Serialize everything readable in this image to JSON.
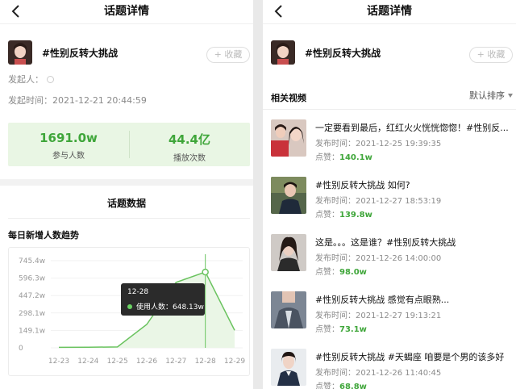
{
  "header": {
    "title": "话题详情"
  },
  "topic": {
    "name": "#性别反转大挑战",
    "fav_label": "+ 收藏"
  },
  "left": {
    "initiator_label": "发起人：",
    "start_time": "发起时间：2021-12-21 20:44:59",
    "stats": [
      {
        "value": "1691.0w",
        "label": "参与人数"
      },
      {
        "value": "44.4亿",
        "label": "播放次数"
      }
    ],
    "section_title": "话题数据",
    "trend_title": "每日新增人数趋势"
  },
  "chart_data": {
    "type": "area",
    "x": [
      "12-23",
      "12-24",
      "12-25",
      "12-26",
      "12-27",
      "12-28",
      "12-29"
    ],
    "y_ticks": [
      "745.4w",
      "596.3w",
      "447.2w",
      "298.1w",
      "149.1w",
      "0"
    ],
    "ylim": [
      0,
      745.4
    ],
    "series": [
      {
        "values": [
          4,
          5,
          8,
          200,
          560,
          648.13,
          150
        ]
      }
    ],
    "tooltip": {
      "date": "12-28",
      "label": "使用人数：",
      "value": "648.13w"
    },
    "color": "#6ac35f"
  },
  "right": {
    "related_title": "相关视频",
    "sort_label": "默认排序",
    "videos": [
      {
        "title": "一定要看到最后，红红火火恍恍惚惚！#性别反...",
        "time": "发布时间：2021-12-25 19:39:35",
        "likes_label": "点赞：",
        "likes": "140.1w"
      },
      {
        "title": "#性别反转大挑战 如何?",
        "time": "发布时间：2021-12-27 18:53:19",
        "likes_label": "点赞：",
        "likes": "139.8w"
      },
      {
        "title": "这是。。。这是谁？#性别反转大挑战",
        "time": "发布时间：2021-12-26 14:00:00",
        "likes_label": "点赞：",
        "likes": "98.0w"
      },
      {
        "title": "#性别反转大挑战 感觉有点眼熟...",
        "time": "发布时间：2021-12-27 19:13:21",
        "likes_label": "点赞：",
        "likes": "73.1w"
      },
      {
        "title": "#性别反转大挑战 #天蝎座 咱要是个男的该多好",
        "time": "发布时间：2021-12-26 11:40:45",
        "likes_label": "点赞：",
        "likes": "68.8w"
      }
    ]
  }
}
